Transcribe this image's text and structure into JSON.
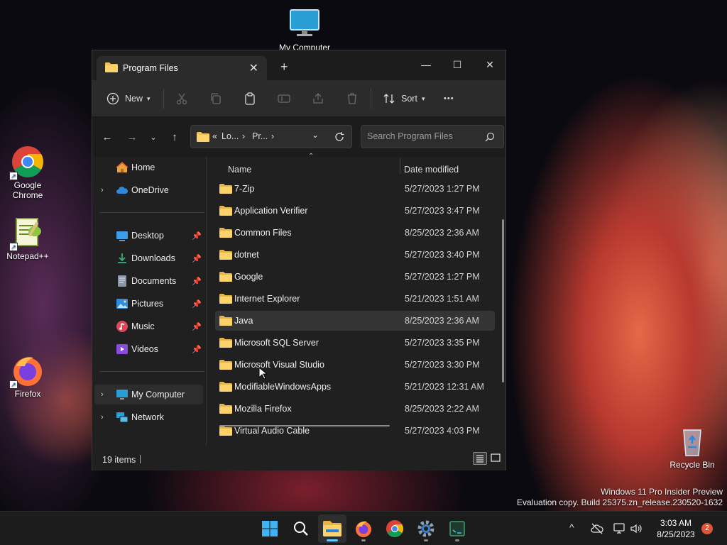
{
  "desktop": {
    "icons": [
      {
        "label": "My Computer"
      },
      {
        "label": "Google Chrome"
      },
      {
        "label": "Notepad++"
      },
      {
        "label": "Firefox"
      },
      {
        "label": "Recycle Bin"
      }
    ],
    "watermark_line1": "Windows 11 Pro Insider Preview",
    "watermark_line2": "Evaluation copy. Build 25375.zn_release.230520-1632"
  },
  "window": {
    "tab_title": "Program Files",
    "close_tab_glyph": "✕",
    "new_tab_glyph": "+",
    "caption": {
      "minimize": "—",
      "maximize": "☐",
      "close": "✕"
    },
    "toolbar": {
      "new_label": "New",
      "sort_label": "Sort",
      "more_glyph": "•••"
    },
    "address": {
      "prefix": "«",
      "crumbs": [
        "Lo...",
        "Pr..."
      ],
      "separator": "›"
    },
    "search_placeholder": "Search Program Files",
    "sidebar": {
      "top": [
        {
          "label": "Home",
          "icon": "home-icon"
        },
        {
          "label": "OneDrive",
          "icon": "cloud-icon"
        }
      ],
      "quick": [
        {
          "label": "Desktop",
          "icon": "desktop-icon"
        },
        {
          "label": "Downloads",
          "icon": "download-icon"
        },
        {
          "label": "Documents",
          "icon": "document-icon"
        },
        {
          "label": "Pictures",
          "icon": "picture-icon"
        },
        {
          "label": "Music",
          "icon": "music-icon"
        },
        {
          "label": "Videos",
          "icon": "video-icon"
        }
      ],
      "bottom": [
        {
          "label": "My Computer",
          "icon": "computer-icon"
        },
        {
          "label": "Network",
          "icon": "network-icon"
        }
      ]
    },
    "columns": {
      "name": "Name",
      "date": "Date modified"
    },
    "files": [
      {
        "name": "7-Zip",
        "date": "5/27/2023 1:27 PM"
      },
      {
        "name": "Application Verifier",
        "date": "5/27/2023 3:47 PM"
      },
      {
        "name": "Common Files",
        "date": "8/25/2023 2:36 AM"
      },
      {
        "name": "dotnet",
        "date": "5/27/2023 3:40 PM"
      },
      {
        "name": "Google",
        "date": "5/27/2023 1:27 PM"
      },
      {
        "name": "Internet Explorer",
        "date": "5/21/2023 1:51 AM"
      },
      {
        "name": "Java",
        "date": "8/25/2023 2:36 AM"
      },
      {
        "name": "Microsoft SQL Server",
        "date": "5/27/2023 3:35 PM"
      },
      {
        "name": "Microsoft Visual Studio",
        "date": "5/27/2023 3:30 PM"
      },
      {
        "name": "ModifiableWindowsApps",
        "date": "5/21/2023 12:31 AM"
      },
      {
        "name": "Mozilla Firefox",
        "date": "8/25/2023 2:22 AM"
      },
      {
        "name": "Virtual Audio Cable",
        "date": "5/27/2023 4:03 PM"
      }
    ],
    "status": {
      "items": "19 items"
    }
  },
  "taskbar": {
    "time": "3:03 AM",
    "date": "8/25/2023",
    "notifications": "2",
    "tray_chevron": "^"
  },
  "colors": {
    "accent": "#60cdff",
    "folder": "#f4c152",
    "selection": "#353535"
  }
}
